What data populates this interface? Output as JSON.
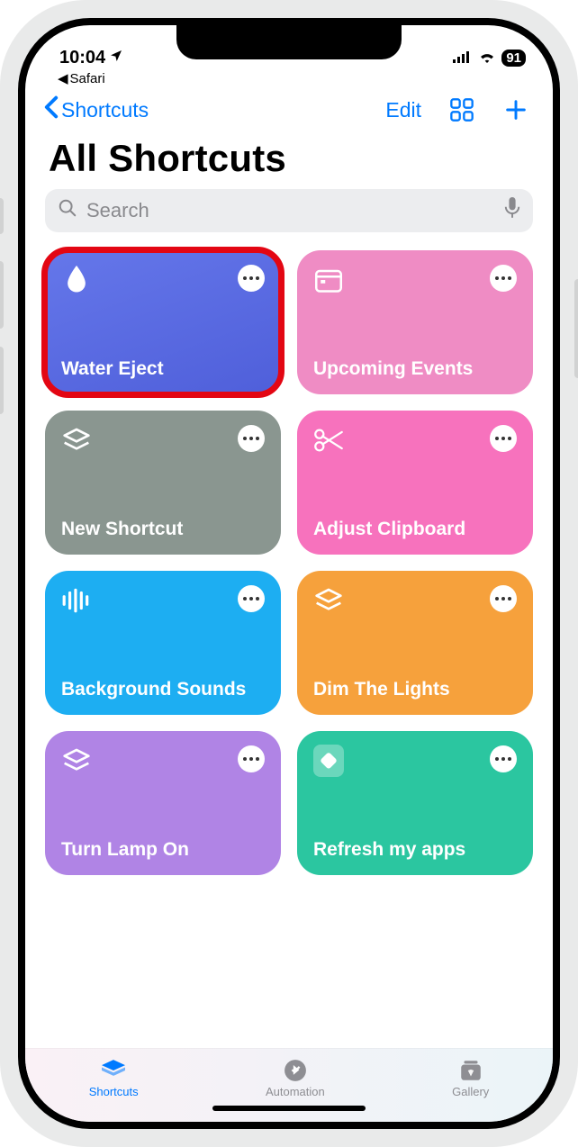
{
  "status": {
    "time": "10:04",
    "back_app": "Safari",
    "battery": "91"
  },
  "nav": {
    "back_label": "Shortcuts",
    "edit_label": "Edit"
  },
  "page_title": "All Shortcuts",
  "search": {
    "placeholder": "Search"
  },
  "cards": [
    {
      "title": "Water Eject",
      "icon": "water-drop-icon",
      "color": "#5a6be6",
      "highlight": true
    },
    {
      "title": "Upcoming Events",
      "icon": "calendar-icon",
      "color": "#ef8cc4"
    },
    {
      "title": "New Shortcut",
      "icon": "layers-icon",
      "color": "#8a9690"
    },
    {
      "title": "Adjust Clipboard",
      "icon": "scissors-icon",
      "color": "#f772bd"
    },
    {
      "title": "Background Sounds",
      "icon": "soundwave-icon",
      "color": "#1daef2"
    },
    {
      "title": "Dim The Lights",
      "icon": "layers-icon",
      "color": "#f6a13c"
    },
    {
      "title": "Turn Lamp On",
      "icon": "layers-icon",
      "color": "#b084e5"
    },
    {
      "title": "Refresh my apps",
      "icon": "app-diamond-icon",
      "color": "#2bc6a0"
    }
  ],
  "tabs": {
    "shortcuts": "Shortcuts",
    "automation": "Automation",
    "gallery": "Gallery"
  }
}
